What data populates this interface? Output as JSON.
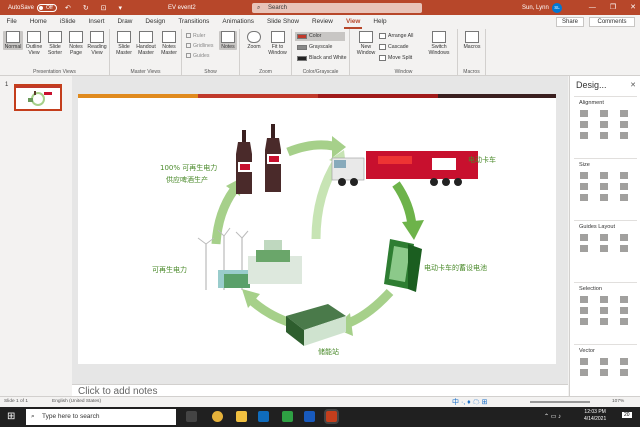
{
  "titlebar": {
    "autosave_label": "AutoSave",
    "autosave_state": "Off",
    "doc_title": "EV event2",
    "search_placeholder": "Search",
    "user_name": "Sun, Lynn",
    "user_initials": "SL",
    "minimize": "—",
    "restore": "❐",
    "close": "✕",
    "qa_icons": "↶ ↻ ⊡ ▾"
  },
  "menu": [
    "File",
    "Home",
    "iSlide",
    "Insert",
    "Draw",
    "Design",
    "Transitions",
    "Animations",
    "Slide Show",
    "Review",
    "View",
    "Help"
  ],
  "menu_active": "View",
  "share_label": "Share",
  "comments_label": "Comments",
  "ribbon": {
    "presentation_views": {
      "label": "Presentation Views",
      "buttons": [
        "Normal",
        "Outline View",
        "Slide Sorter",
        "Notes Page",
        "Reading View"
      ]
    },
    "master_views": {
      "label": "Master Views",
      "buttons": [
        "Slide Master",
        "Handout Master",
        "Notes Master"
      ]
    },
    "show": {
      "label": "Show",
      "checks": [
        {
          "label": "Ruler",
          "checked": false
        },
        {
          "label": "Gridlines",
          "checked": false
        },
        {
          "label": "Guides",
          "checked": false
        }
      ],
      "notes_button": "Notes"
    },
    "zoom": {
      "label": "Zoom",
      "buttons": [
        "Zoom",
        "Fit to Window"
      ]
    },
    "color": {
      "label": "Color/Grayscale",
      "options": [
        {
          "label": "Color",
          "color": "#c0392b"
        },
        {
          "label": "Grayscale",
          "color": "#888888"
        },
        {
          "label": "Black and White",
          "color": "#222222"
        }
      ]
    },
    "window": {
      "label": "Window",
      "new_window": "New Window",
      "arrange_all": "Arrange All",
      "cascade": "Cascade",
      "move_split": "Move Split",
      "switch": "Switch Windows"
    },
    "macros": {
      "label": "Macros",
      "button": "Macros"
    }
  },
  "thumbnail_number": "1",
  "slide": {
    "label_renewable_top": "100% 可再生电力",
    "label_renewable_top2": "供应啤酒生产",
    "label_truck": "电动卡车",
    "label_battery": "电动卡车的蓄设电池",
    "label_renewable": "可再生电力",
    "label_storage": "储能站"
  },
  "notes_placeholder": "Click to add notes",
  "designer": {
    "title": "Desig...",
    "close": "✕",
    "sections": [
      "Alignment",
      "Size",
      "Guides Layout",
      "Selection",
      "Vector"
    ]
  },
  "status": {
    "slide_of": "Slide 1 of 1",
    "language": "English (United States)",
    "zoom": "107%",
    "ime": "中 ·, ♦ ☁ ⊞"
  },
  "taskbar": {
    "search_placeholder": "Type here to search",
    "time": "12:03 PM",
    "date": "4/14/2021",
    "notification_count": "20"
  },
  "colors": {
    "accent": "#b7472a",
    "green_dark": "#2e7d32",
    "green_light": "#a6d08a",
    "label_green": "#4a8a2a",
    "truck_red": "#c8102e"
  }
}
